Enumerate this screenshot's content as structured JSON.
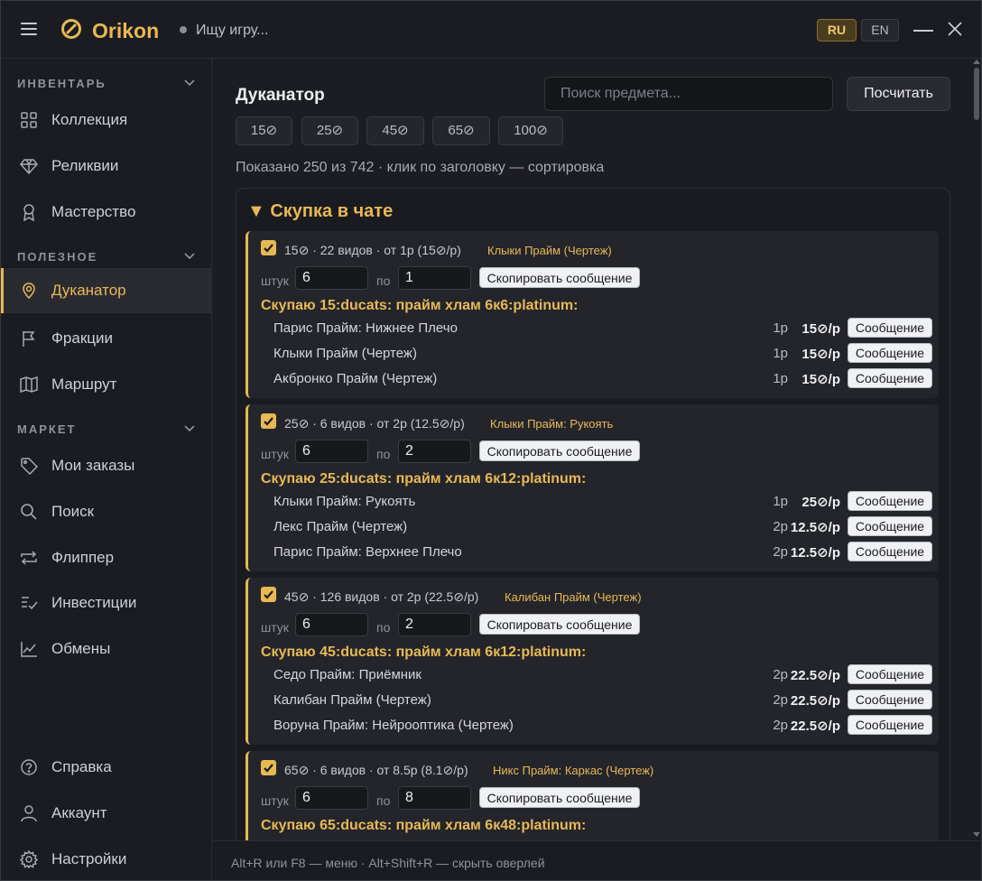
{
  "app": {
    "name": "Orikon",
    "status": "Ищу игру...",
    "lang_active": "RU",
    "lang_other": "EN",
    "accent_color": "#e7b955"
  },
  "sidebar": {
    "sections": [
      {
        "title": "ИНВЕНТАРЬ",
        "items": [
          {
            "label": "Коллекция",
            "icon": "grid-icon"
          },
          {
            "label": "Реликвии",
            "icon": "diamond-icon"
          },
          {
            "label": "Мастерство",
            "icon": "medal-icon"
          }
        ]
      },
      {
        "title": "ПОЛЕЗНОЕ",
        "items": [
          {
            "label": "Дуканатор",
            "icon": "ducat-icon",
            "active": true
          },
          {
            "label": "Фракции",
            "icon": "flag-icon"
          },
          {
            "label": "Маршрут",
            "icon": "map-icon"
          }
        ]
      },
      {
        "title": "МАРКЕТ",
        "items": [
          {
            "label": "Мои заказы",
            "icon": "tag-icon"
          },
          {
            "label": "Поиск",
            "icon": "search-icon"
          },
          {
            "label": "Флиппер",
            "icon": "swap-icon"
          },
          {
            "label": "Инвестиции",
            "icon": "invest-icon"
          },
          {
            "label": "Обмены",
            "icon": "chart-icon"
          }
        ]
      }
    ],
    "bottom": [
      {
        "label": "Справка",
        "icon": "help-icon"
      },
      {
        "label": "Аккаунт",
        "icon": "user-icon"
      },
      {
        "label": "Настройки",
        "icon": "gear-icon"
      }
    ]
  },
  "main": {
    "title": "Дуканатор",
    "search_placeholder": "Поиск предмета...",
    "calc_label": "Посчитать",
    "chips": [
      "15",
      "25",
      "45",
      "65",
      "100"
    ],
    "shown_text": "Показано 250 из 742 · клик по заголовку — сортировка",
    "panel_title": "▼ Скупка в чате",
    "qty_label": "штук",
    "per_label": "по",
    "copy_label": "Скопировать сообщение",
    "row_button": "Сообщение",
    "groups": [
      {
        "head": "15⊘ · 22 видов · от 1р (15⊘/р)",
        "item": "Клыки Прайм (Чертеж)",
        "qty": "6",
        "per": "1",
        "message": "Скупаю 15:ducats: прайм хлам 6к6:platinum:",
        "rows": [
          {
            "name": "Парис Прайм: Нижнее Плечо",
            "qty": "1р",
            "price": "15⊘/р"
          },
          {
            "name": "Клыки Прайм (Чертеж)",
            "qty": "1р",
            "price": "15⊘/р"
          },
          {
            "name": "Акбронко Прайм (Чертеж)",
            "qty": "1р",
            "price": "15⊘/р"
          }
        ]
      },
      {
        "head": "25⊘ · 6 видов · от 2р (12.5⊘/р)",
        "item": "Клыки Прайм: Рукоять",
        "qty": "6",
        "per": "2",
        "message": "Скупаю 25:ducats: прайм хлам 6к12:platinum:",
        "rows": [
          {
            "name": "Клыки Прайм: Рукоять",
            "qty": "1р",
            "price": "25⊘/р"
          },
          {
            "name": "Лекс Прайм (Чертеж)",
            "qty": "2р",
            "price": "12.5⊘/р"
          },
          {
            "name": "Парис Прайм: Верхнее Плечо",
            "qty": "2р",
            "price": "12.5⊘/р"
          }
        ]
      },
      {
        "head": "45⊘ · 126 видов · от 2р (22.5⊘/р)",
        "item": "Калибан Прайм (Чертеж)",
        "qty": "6",
        "per": "2",
        "message": "Скупаю 45:ducats: прайм хлам 6к12:platinum:",
        "rows": [
          {
            "name": "Седо Прайм: Приёмник",
            "qty": "2р",
            "price": "22.5⊘/р"
          },
          {
            "name": "Калибан Прайм (Чертеж)",
            "qty": "2р",
            "price": "22.5⊘/р"
          },
          {
            "name": "Воруна Прайм: Нейрооптика (Чертеж)",
            "qty": "2р",
            "price": "22.5⊘/р"
          }
        ]
      },
      {
        "head": "65⊘ · 6 видов · от 8.5р (8.1⊘/р)",
        "item": "Никс Прайм: Каркас (Чертеж)",
        "qty": "6",
        "per": "8",
        "message": "Скупаю 65:ducats: прайм хлам 6к48:platinum:",
        "rows": []
      }
    ]
  },
  "footer": {
    "hint": "Alt+R или F8 — меню · Alt+Shift+R — скрыть оверлей"
  }
}
